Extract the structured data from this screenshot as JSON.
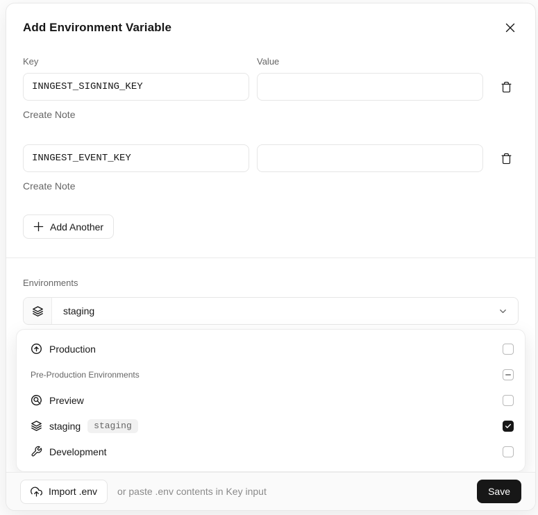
{
  "modal": {
    "title": "Add Environment Variable",
    "key_label": "Key",
    "value_label": "Value",
    "rows": [
      {
        "key": "INNGEST_SIGNING_KEY",
        "value": "",
        "note_label": "Create Note"
      },
      {
        "key": "INNGEST_EVENT_KEY",
        "value": "",
        "note_label": "Create Note"
      }
    ],
    "add_another_label": "Add Another",
    "environments": {
      "label": "Environments",
      "selected_value": "staging",
      "group_label": "Pre-Production Environments",
      "group_checkbox_state": "indeterminate",
      "options": [
        {
          "label": "Production",
          "icon": "circle-arrow-up-icon",
          "checked": false
        },
        {
          "label": "Preview",
          "icon": "magnifier-circle-icon",
          "checked": false
        },
        {
          "label": "staging",
          "badge": "staging",
          "icon": "layers-icon",
          "checked": true
        },
        {
          "label": "Development",
          "icon": "wrench-icon",
          "checked": false
        }
      ]
    },
    "footer": {
      "import_label": "Import .env",
      "hint": "or paste .env contents in Key input",
      "save_label": "Save"
    },
    "colors": {
      "accent_dark": "#171717",
      "border": "#e6e6e6",
      "muted_text": "#666666",
      "badge_bg": "#f1f1f1",
      "footer_bg": "#fafafa"
    }
  }
}
